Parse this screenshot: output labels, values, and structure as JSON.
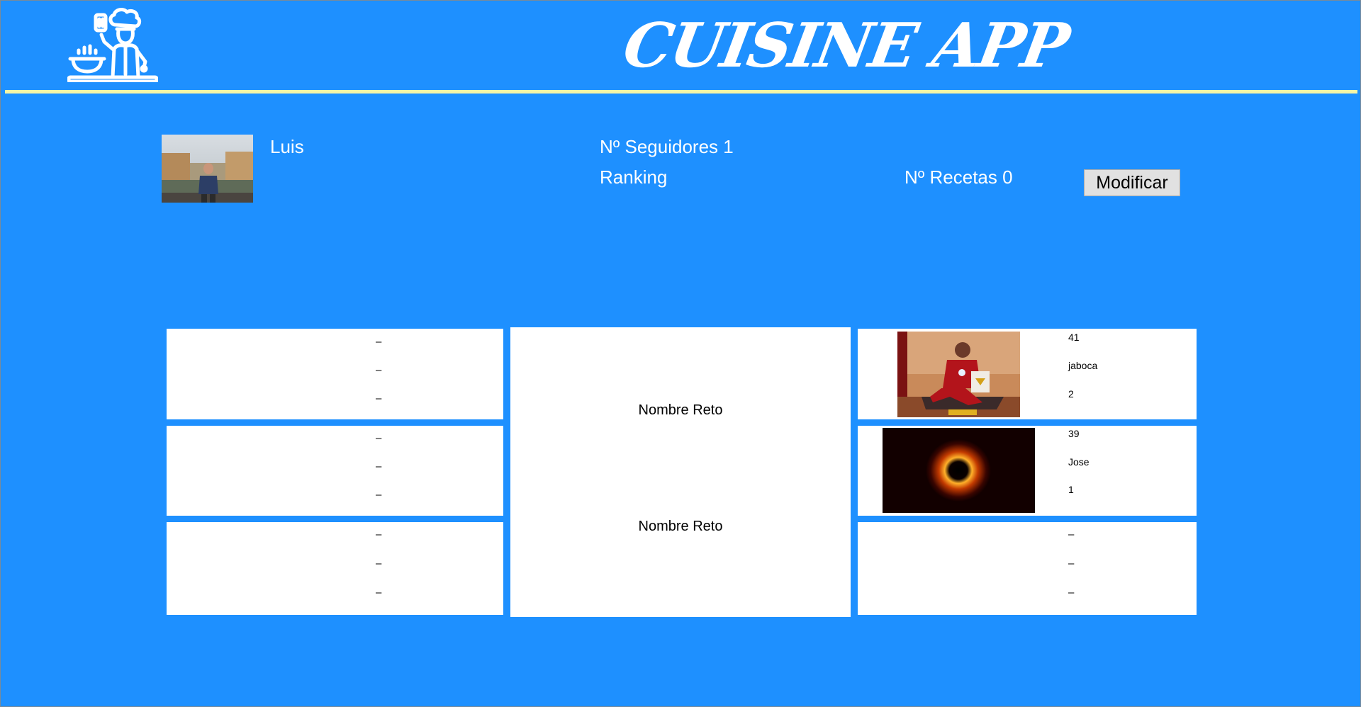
{
  "app": {
    "title": "CUISINE APP",
    "logo_icon": "chef-cooking-icon"
  },
  "profile": {
    "name": "Luis",
    "followers": "Nº Seguidores 1",
    "ranking": "Ranking",
    "recipes": "Nº Recetas 0",
    "modify_button": "Modificar"
  },
  "left_cards": [
    {
      "lines": [
        "–",
        "–",
        "–"
      ]
    },
    {
      "lines": [
        "–",
        "–",
        "–"
      ]
    },
    {
      "lines": [
        "–",
        "–",
        "–"
      ]
    }
  ],
  "center": {
    "reto_1": "Nombre Reto",
    "reto_2": "Nombre Reto"
  },
  "right_cards": [
    {
      "image": "iron-man-figure-photo",
      "lines": [
        "41",
        "jaboca",
        "2"
      ]
    },
    {
      "image": "black-hole-photo",
      "lines": [
        "39",
        "Jose",
        "1"
      ]
    },
    {
      "image": "",
      "lines": [
        "–",
        "–",
        "–"
      ]
    }
  ],
  "colors": {
    "background": "#1e90ff",
    "rule": "#f5f5a6",
    "card": "#ffffff"
  }
}
